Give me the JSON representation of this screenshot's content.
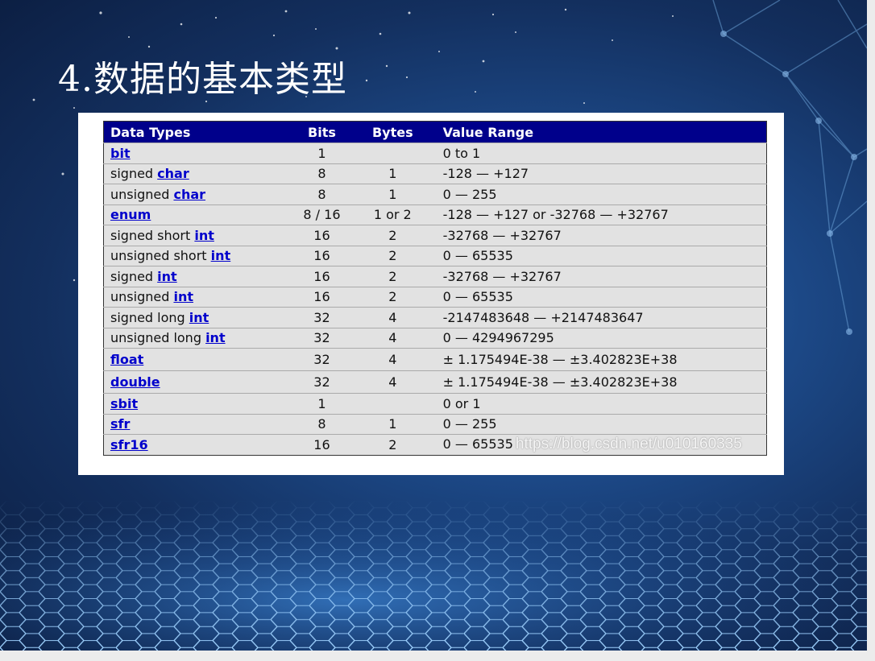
{
  "slide": {
    "title": "4.数据的基本类型"
  },
  "table": {
    "headers": {
      "type": "Data Types",
      "bits": "Bits",
      "bytes": "Bytes",
      "range": "Value Range"
    },
    "rows": [
      {
        "prefix": "",
        "keyword": "bit",
        "bits": "1",
        "bytes": "",
        "range": "0 to 1"
      },
      {
        "prefix": "signed ",
        "keyword": "char",
        "bits": "8",
        "bytes": "1",
        "range": "-128 — +127"
      },
      {
        "prefix": "unsigned ",
        "keyword": "char",
        "bits": "8",
        "bytes": "1",
        "range": "0 — 255"
      },
      {
        "prefix": "",
        "keyword": "enum",
        "bits": "8 / 16",
        "bytes": "1 or 2",
        "range": "-128 — +127 or -32768 — +32767"
      },
      {
        "prefix": "signed short ",
        "keyword": "int",
        "bits": "16",
        "bytes": "2",
        "range": "-32768 — +32767"
      },
      {
        "prefix": "unsigned short ",
        "keyword": "int",
        "bits": "16",
        "bytes": "2",
        "range": "0 — 65535"
      },
      {
        "prefix": "signed ",
        "keyword": "int",
        "bits": "16",
        "bytes": "2",
        "range": "-32768 — +32767"
      },
      {
        "prefix": "unsigned ",
        "keyword": "int",
        "bits": "16",
        "bytes": "2",
        "range": "0 — 65535"
      },
      {
        "prefix": "signed long ",
        "keyword": "int",
        "bits": "32",
        "bytes": "4",
        "range": "-2147483648 — +2147483647"
      },
      {
        "prefix": "unsigned long ",
        "keyword": "int",
        "bits": "32",
        "bytes": "4",
        "range": "0 — 4294967295"
      },
      {
        "prefix": "",
        "keyword": "float",
        "bits": "32",
        "bytes": "4",
        "range": "± 1.175494E-38 — ±3.402823E+38"
      },
      {
        "prefix": "",
        "keyword": "double",
        "bits": "32",
        "bytes": "4",
        "range": "± 1.175494E-38 — ±3.402823E+38"
      },
      {
        "prefix": "",
        "keyword": "sbit",
        "bits": "1",
        "bytes": "",
        "range": "0 or 1"
      },
      {
        "prefix": "",
        "keyword": "sfr",
        "bits": "8",
        "bytes": "1",
        "range": "0 — 255"
      },
      {
        "prefix": "",
        "keyword": "sfr16",
        "bits": "16",
        "bytes": "2",
        "range": "0 — 65535"
      }
    ],
    "watermark": "https://blog.csdn.net/u010160335"
  },
  "colors": {
    "header_bg": "#00008b",
    "row_bg": "#e2e2e2",
    "keyword_link": "#0000cc",
    "slide_bg_center": "#2e6ab0",
    "slide_bg_edge": "#0b1d40"
  }
}
